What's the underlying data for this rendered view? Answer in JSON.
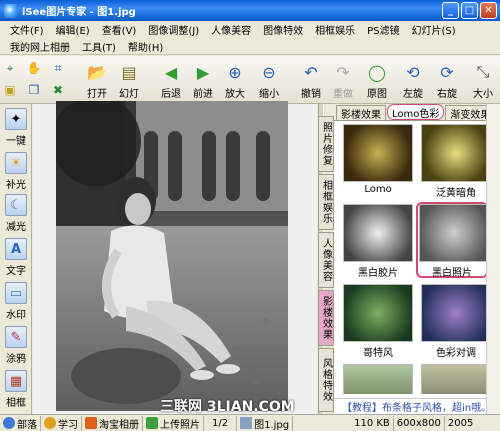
{
  "window": {
    "title": "iSee图片专家 - 图1.jpg"
  },
  "menu": {
    "row1": [
      "文件(F)",
      "编辑(E)",
      "查看(V)",
      "图像调整(J)",
      "人像美容",
      "图像特效",
      "相框娱乐",
      "PS滤镜",
      "幻灯片(S)"
    ],
    "row2": [
      "我的网上相册",
      "工具(T)",
      "帮助(H)"
    ]
  },
  "toolbar": {
    "open": "打开",
    "slideshow": "幻灯",
    "back": "后退",
    "forward": "前进",
    "zoom_in": "放大",
    "zoom_out": "缩小",
    "undo": "撤销",
    "redo": "重做",
    "original": "原图",
    "rotate_left": "左旋",
    "rotate_right": "右旋",
    "size": "大小"
  },
  "left_tools": [
    "一键",
    "补光",
    "减光",
    "文字",
    "水印",
    "涂鸦",
    "相框"
  ],
  "side_tabs": [
    "照片修复",
    "相框娱乐",
    "人像美容",
    "影楼效果",
    "风格特效"
  ],
  "effect_tabs": [
    "影楼效果",
    "Lomo色彩",
    "渐变效果"
  ],
  "effects": [
    "Lomo",
    "泛黄暗角",
    "黑白胶片",
    "黑白照片",
    "哥特风",
    "色彩对调"
  ],
  "tip": "【教程】布条格子风格，超in哦。",
  "status": {
    "links": [
      "部落",
      "学习",
      "淘宝相册",
      "上传照片"
    ],
    "page": "1/2",
    "filename": "图1.jpg",
    "size": "110 KB",
    "dimensions": "600x800",
    "date": "2005"
  },
  "watermark": "三联网 3LIAN.COM"
}
